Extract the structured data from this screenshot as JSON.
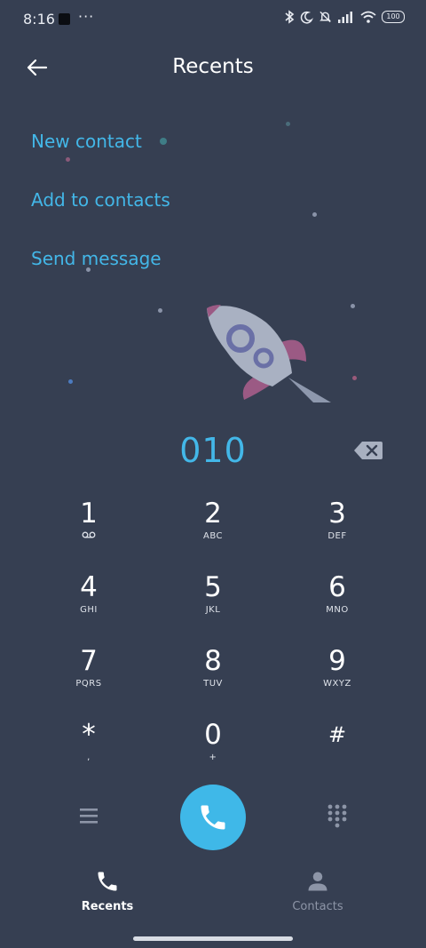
{
  "status_bar": {
    "time": "8:16",
    "more": "···",
    "battery": "100"
  },
  "header": {
    "title": "Recents",
    "back_icon": "arrow-left-icon"
  },
  "menu": {
    "items": [
      {
        "label": "New contact"
      },
      {
        "label": "Add to contacts"
      },
      {
        "label": "Send message"
      }
    ]
  },
  "dialer": {
    "number": "010",
    "keys": [
      {
        "digit": "1",
        "letters": ""
      },
      {
        "digit": "2",
        "letters": "ABC"
      },
      {
        "digit": "3",
        "letters": "DEF"
      },
      {
        "digit": "4",
        "letters": "GHI"
      },
      {
        "digit": "5",
        "letters": "JKL"
      },
      {
        "digit": "6",
        "letters": "MNO"
      },
      {
        "digit": "7",
        "letters": "PQRS"
      },
      {
        "digit": "8",
        "letters": "TUV"
      },
      {
        "digit": "9",
        "letters": "WXYZ"
      },
      {
        "digit": "*",
        "letters": ","
      },
      {
        "digit": "0",
        "letters": "+"
      },
      {
        "digit": "#",
        "letters": ""
      }
    ]
  },
  "tabs": [
    {
      "label": "Recents",
      "icon": "phone-icon",
      "active": true
    },
    {
      "label": "Contacts",
      "icon": "person-icon",
      "active": false
    }
  ],
  "colors": {
    "background": "#363f52",
    "accent": "#43b7e8",
    "call_button": "#3fb8e8",
    "inactive": "#8d95a7"
  }
}
